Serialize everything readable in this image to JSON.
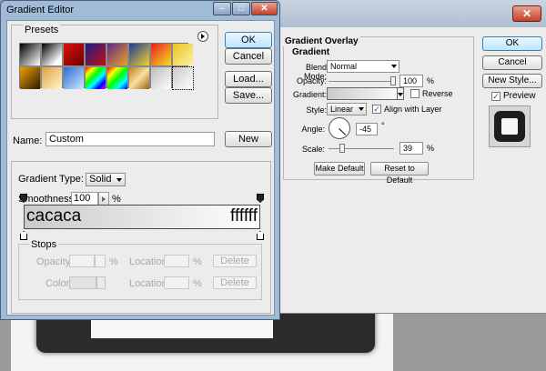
{
  "gradient_editor": {
    "title": "Gradient Editor",
    "presets_label": "Presets",
    "buttons": {
      "ok": "OK",
      "cancel": "Cancel",
      "load": "Load...",
      "save": "Save...",
      "new": "New"
    },
    "name_label": "Name:",
    "name_value": "Custom",
    "gradient_type_label": "Gradient Type:",
    "gradient_type_value": "Solid",
    "smoothness_label": "Smoothness:",
    "smoothness_value": "100",
    "smoothness_unit": "%",
    "gradient_start_color_text": "cacaca",
    "gradient_end_color_text": "ffffff",
    "gradient_colors": {
      "start": "#cacaca",
      "end": "#ffffff"
    },
    "stops": {
      "label": "Stops",
      "opacity_label": "Opacity:",
      "opacity_unit": "%",
      "color_label": "Color:",
      "location_label": "Location:",
      "location_unit": "%",
      "delete_label": "Delete"
    }
  },
  "layer_style": {
    "section_title": "Gradient Overlay",
    "subsection_title": "Gradient",
    "blend_mode_label": "Blend Mode:",
    "blend_mode_value": "Normal",
    "opacity_label": "Opacity:",
    "opacity_value": "100",
    "opacity_unit": "%",
    "gradient_label": "Gradient:",
    "reverse_label": "Reverse",
    "style_label": "Style:",
    "style_value": "Linear",
    "align_label": "Align with Layer",
    "angle_label": "Angle:",
    "angle_value": "-45",
    "angle_unit": "°",
    "scale_label": "Scale:",
    "scale_value": "39",
    "scale_unit": "%",
    "make_default": "Make Default",
    "reset_default": "Reset to Default",
    "buttons": {
      "ok": "OK",
      "cancel": "Cancel",
      "new_style": "New Style..."
    },
    "preview_label": "Preview",
    "preview_checked": true,
    "align_checked": true,
    "reverse_checked": false
  }
}
